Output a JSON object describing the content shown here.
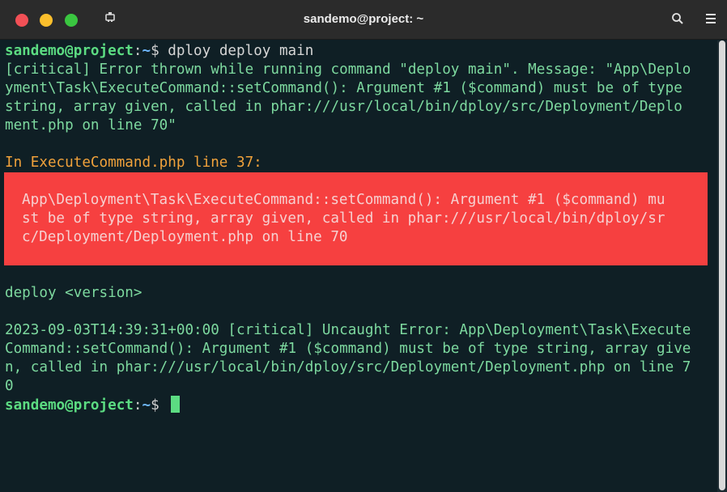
{
  "window": {
    "title": "sandemo@project: ~"
  },
  "icons": {
    "terminal": "terminal-icon",
    "search": "search-icon",
    "menu": "hamburger-menu-icon"
  },
  "colors": {
    "background": "#0f1f25",
    "prompt_user": "#5cdc82",
    "prompt_path": "#6fb8ff",
    "output_text": "#7dd99f",
    "error_background": "#f64040",
    "heading_orange": "#f1a23b"
  },
  "terminal": {
    "prompt": {
      "user_host": "sandemo@project",
      "separator": ":",
      "path": "~",
      "symbol": "$ "
    },
    "command": "dploy deploy main",
    "critical_lines": [
      "[critical] Error thrown while running command \"deploy main\". Message: \"App\\Deplo",
      "yment\\Task\\ExecuteCommand::setCommand(): Argument #1 ($command) must be of type",
      "string, array given, called in phar:///usr/local/bin/dploy/src/Deployment/Deplo",
      "ment.php on line 70\""
    ],
    "in_file": "In ExecuteCommand.php line 37:",
    "error_box_lines": [
      "App\\Deployment\\Task\\ExecuteCommand::setCommand(): Argument #1 ($command) mu",
      "st be of type string, array given, called in phar:///usr/local/bin/dploy/sr",
      "c/Deployment/Deployment.php on line 70"
    ],
    "usage": "deploy <version>",
    "uncaught_lines": [
      "2023-09-03T14:39:31+00:00 [critical] Uncaught Error: App\\Deployment\\Task\\Execute",
      "Command::setCommand(): Argument #1 ($command) must be of type string, array give",
      "n, called in phar:///usr/local/bin/dploy/src/Deployment/Deployment.php on line 7",
      "0"
    ]
  }
}
